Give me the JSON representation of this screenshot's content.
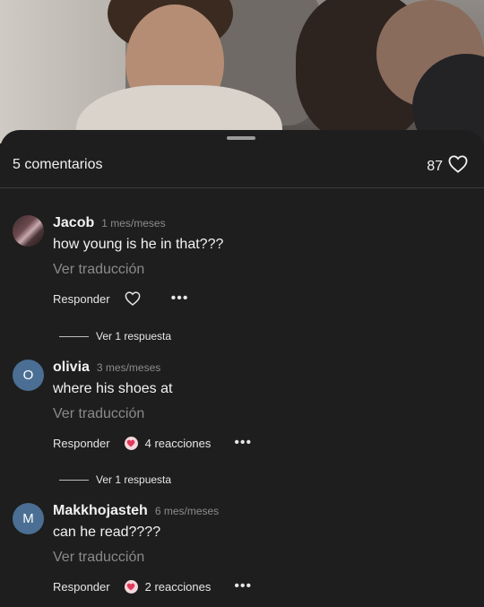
{
  "header": {
    "comment_count": "5 comentarios",
    "like_count": "87",
    "heart_icon": "heart-outline-icon"
  },
  "comments": [
    {
      "author": "Jacob",
      "time": "1 mes/meses",
      "text": "how young is he in that???",
      "translate": "Ver traducción",
      "reply": "Responder",
      "reactions": "",
      "avatar_letter": ""
    },
    {
      "author": "olivia",
      "time": "3 mes/meses",
      "text": "where his shoes at",
      "translate": "Ver traducción",
      "reply": "Responder",
      "reactions": "4 reacciones",
      "avatar_letter": "O"
    },
    {
      "author": "Makkhojasteh",
      "time": "6 mes/meses",
      "text": "can he read????",
      "translate": "Ver traducción",
      "reply": "Responder",
      "reactions": "2 reacciones",
      "avatar_letter": "M"
    }
  ],
  "view_replies": [
    "Ver 1 respuesta",
    "Ver 1 respuesta"
  ],
  "colors": {
    "background": "#1e1e1e",
    "avatar_blue": "#4b6f94",
    "muted_text": "#8a8a8a"
  }
}
